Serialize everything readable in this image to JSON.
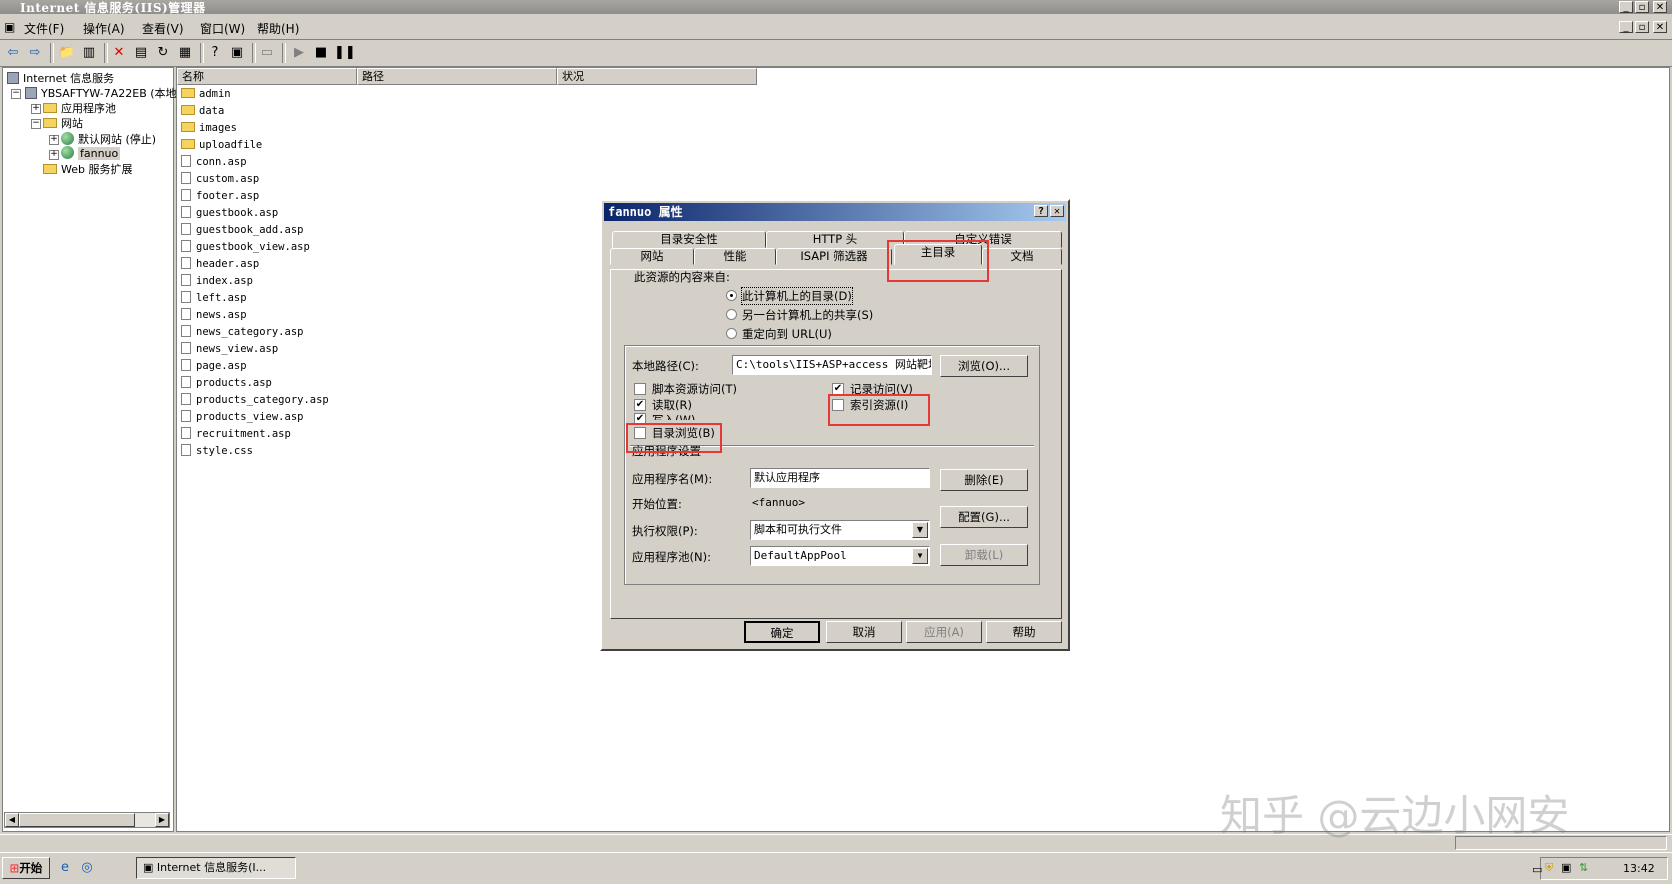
{
  "window": {
    "title": "Internet 信息服务(IIS)管理器"
  },
  "menu": [
    "文件(F)",
    "操作(A)",
    "查看(V)",
    "窗口(W)",
    "帮助(H)"
  ],
  "tree": {
    "root": "Internet 信息服务",
    "server": "YBSAFTYW-7A22EB (本地计",
    "app_pools": "应用程序池",
    "websites": "网站",
    "default_site": "默认网站 (停止)",
    "fannuo": "fannuo",
    "web_ext": "Web 服务扩展"
  },
  "list": {
    "columns": [
      "名称",
      "路径",
      "状况"
    ],
    "folders": [
      "admin",
      "data",
      "images",
      "uploadfile"
    ],
    "files": [
      "conn.asp",
      "custom.asp",
      "footer.asp",
      "guestbook.asp",
      "guestbook_add.asp",
      "guestbook_view.asp",
      "header.asp",
      "index.asp",
      "left.asp",
      "news.asp",
      "news_category.asp",
      "news_view.asp",
      "page.asp",
      "products.asp",
      "products_category.asp",
      "products_view.asp",
      "recruitment.asp",
      "style.css"
    ]
  },
  "dialog": {
    "title": "fannuo 属性",
    "tabs_row1": [
      "目录安全性",
      "HTTP 头",
      "自定义错误"
    ],
    "tabs_row2": [
      "网站",
      "性能",
      "ISAPI 筛选器",
      "主目录",
      "文档"
    ],
    "source_label": "此资源的内容来自:",
    "radio_local": "此计算机上的目录(D)",
    "radio_share": "另一台计算机上的共享(S)",
    "radio_url": "重定向到 URL(U)",
    "local_path_label": "本地路径(C):",
    "local_path_value": "C:\\tools\\IIS+ASP+access 网站靶场\\",
    "browse": "浏览(O)...",
    "chk_script": "脚本资源访问(T)",
    "chk_log": "记录访问(V)",
    "chk_read": "读取(R)",
    "chk_index": "索引资源(I)",
    "chk_write": "写入(W)",
    "chk_dirbrowse": "目录浏览(B)",
    "app_settings": "应用程序设置",
    "app_name_label": "应用程序名(M):",
    "app_name_value": "默认应用程序",
    "remove": "删除(E)",
    "start_label": "开始位置:",
    "start_value": "<fannuo>",
    "config": "配置(G)...",
    "exec_label": "执行权限(P):",
    "exec_value": "脚本和可执行文件",
    "unload": "卸载(L)",
    "pool_label": "应用程序池(N):",
    "pool_value": "DefaultAppPool",
    "ok": "确定",
    "cancel": "取消",
    "apply": "应用(A)",
    "help": "帮助"
  },
  "taskbar": {
    "start": "开始",
    "task": "Internet 信息服务(I...",
    "clock": "13:42"
  },
  "watermark": "知乎 @云边小网安"
}
